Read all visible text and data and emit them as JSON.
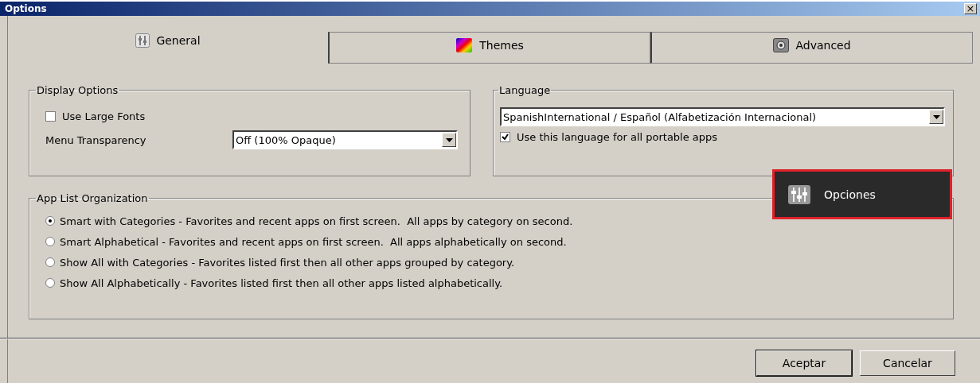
{
  "window": {
    "title": "Options",
    "close": "×"
  },
  "tabs": [
    {
      "label": "General",
      "kind": "general",
      "selected": true
    },
    {
      "label": "Themes",
      "kind": "themes",
      "selected": false
    },
    {
      "label": "Advanced",
      "kind": "advanced",
      "selected": false
    }
  ],
  "display_options": {
    "title": "Display Options",
    "large_fonts": {
      "label": "Use Large Fonts",
      "checked": false
    },
    "transparency": {
      "label": "Menu Transparency",
      "value": "Off (100% Opaque)"
    }
  },
  "language": {
    "title": "Language",
    "value": "SpanishInternational / Español (Alfabetización Internacional)",
    "all_apps": {
      "label": "Use this language for all portable apps",
      "checked": true
    }
  },
  "app_list": {
    "title": "App List Organization",
    "options": [
      {
        "label": "Smart with Categories - Favorites and recent apps on first screen.  All apps by category on second.",
        "selected": true
      },
      {
        "label": "Smart Alphabetical - Favorites and recent apps on first screen.  All apps alphabetically on second.",
        "selected": false
      },
      {
        "label": "Show All with Categories - Favorites listed first then all other apps grouped by category.",
        "selected": false
      },
      {
        "label": "Show All Alphabetically - Favorites listed first then all other apps listed alphabetically.",
        "selected": false
      }
    ]
  },
  "callout": {
    "label": "Opciones"
  },
  "buttons": [
    {
      "label": "Aceptar",
      "kind": "default"
    },
    {
      "label": "Cancelar",
      "kind": "normal"
    }
  ]
}
